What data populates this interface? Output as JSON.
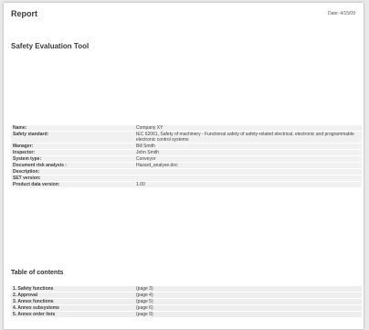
{
  "header": {
    "title": "Report",
    "date": "Date: 4/15/09"
  },
  "tool_title": "Safety Evaluation Tool",
  "details": [
    {
      "label": "Name:",
      "value": "Company XY"
    },
    {
      "label": "Safety standard:",
      "value": "IEC 62061, Safety of machinery - Functional safety of safety-related electrical, electronic and programmable electronic control systems"
    },
    {
      "label": "Manager:",
      "value": "Bill Smith"
    },
    {
      "label": "Inspector:",
      "value": "John Smith"
    },
    {
      "label": "System type:",
      "value": "Conveyor"
    },
    {
      "label": "Document risk analysis :",
      "value": "Hazard_analyse.doc"
    },
    {
      "label": "Description:",
      "value": ""
    },
    {
      "label": "SET version:",
      "value": ""
    },
    {
      "label": "Product data version:",
      "value": "1.00"
    }
  ],
  "toc": {
    "title": "Table of contents",
    "items": [
      {
        "label": "1. Safety functions",
        "page": "(page 3)"
      },
      {
        "label": "2. Approval",
        "page": "(page 4)"
      },
      {
        "label": "3. Annex functions",
        "page": "(page 5)"
      },
      {
        "label": "4. Annex subsystems",
        "page": "(page 6)"
      },
      {
        "label": "5. Annex order lists",
        "page": "(page 9)"
      }
    ]
  }
}
